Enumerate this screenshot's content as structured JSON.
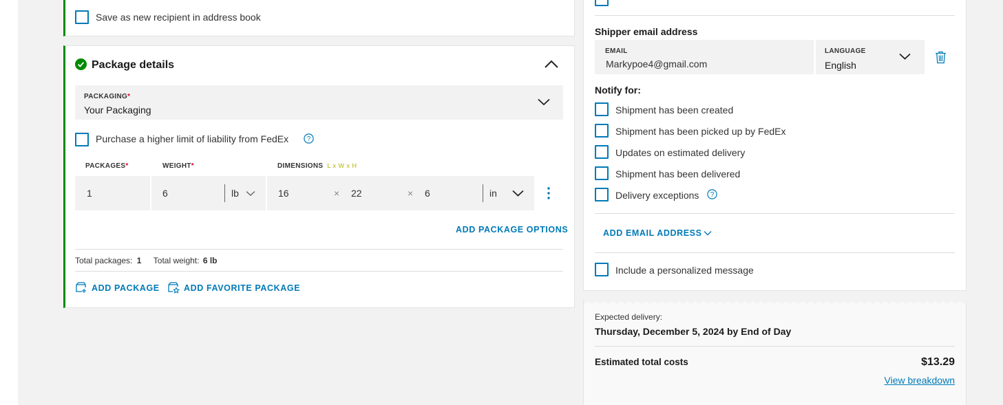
{
  "recipient": {
    "save_label": "Save as new recipient in address book"
  },
  "package": {
    "title": "Package details",
    "packaging": {
      "label": "PACKAGING",
      "required_mark": "*",
      "value": "Your Packaging"
    },
    "liability_label": "Purchase a higher limit of liability from FedEx",
    "columns": {
      "packages": "PACKAGES",
      "weight": "WEIGHT",
      "dimensions": "DIMENSIONS",
      "dimensions_hint": "L x W x H",
      "required_mark": "*"
    },
    "row": {
      "packages": "1",
      "weight": "6",
      "weight_unit": "lb",
      "length": "16",
      "width": "22",
      "height": "6",
      "dim_unit": "in",
      "times": "×"
    },
    "add_options": "ADD PACKAGE OPTIONS",
    "totals": {
      "packages_label": "Total packages:",
      "packages_value": "1",
      "weight_label": "Total weight:",
      "weight_value": "6 lb"
    },
    "add_package": "ADD PACKAGE",
    "add_favorite": "ADD FAVORITE PACKAGE"
  },
  "notify": {
    "shipper_email_title": "Shipper email address",
    "email_label": "EMAIL",
    "email_value": "Markypoe4@gmail.com",
    "language_label": "LANGUAGE",
    "language_value": "English",
    "notify_for": "Notify for:",
    "options": [
      "Shipment has been created",
      "Shipment has been picked up by FedEx",
      "Updates on estimated delivery",
      "Shipment has been delivered",
      "Delivery exceptions"
    ],
    "add_email": "ADD EMAIL ADDRESS",
    "personal_message": "Include a personalized message"
  },
  "summary": {
    "expected_label": "Expected delivery:",
    "expected_value": "Thursday, December 5, 2024 by End of Day",
    "total_label": "Estimated total costs",
    "total_value": "$13.29",
    "breakdown_link": "View breakdown"
  },
  "colors": {
    "accent": "#007ab7",
    "success": "#008a00",
    "required": "#de002e",
    "field_bg": "#f2f2f2"
  }
}
